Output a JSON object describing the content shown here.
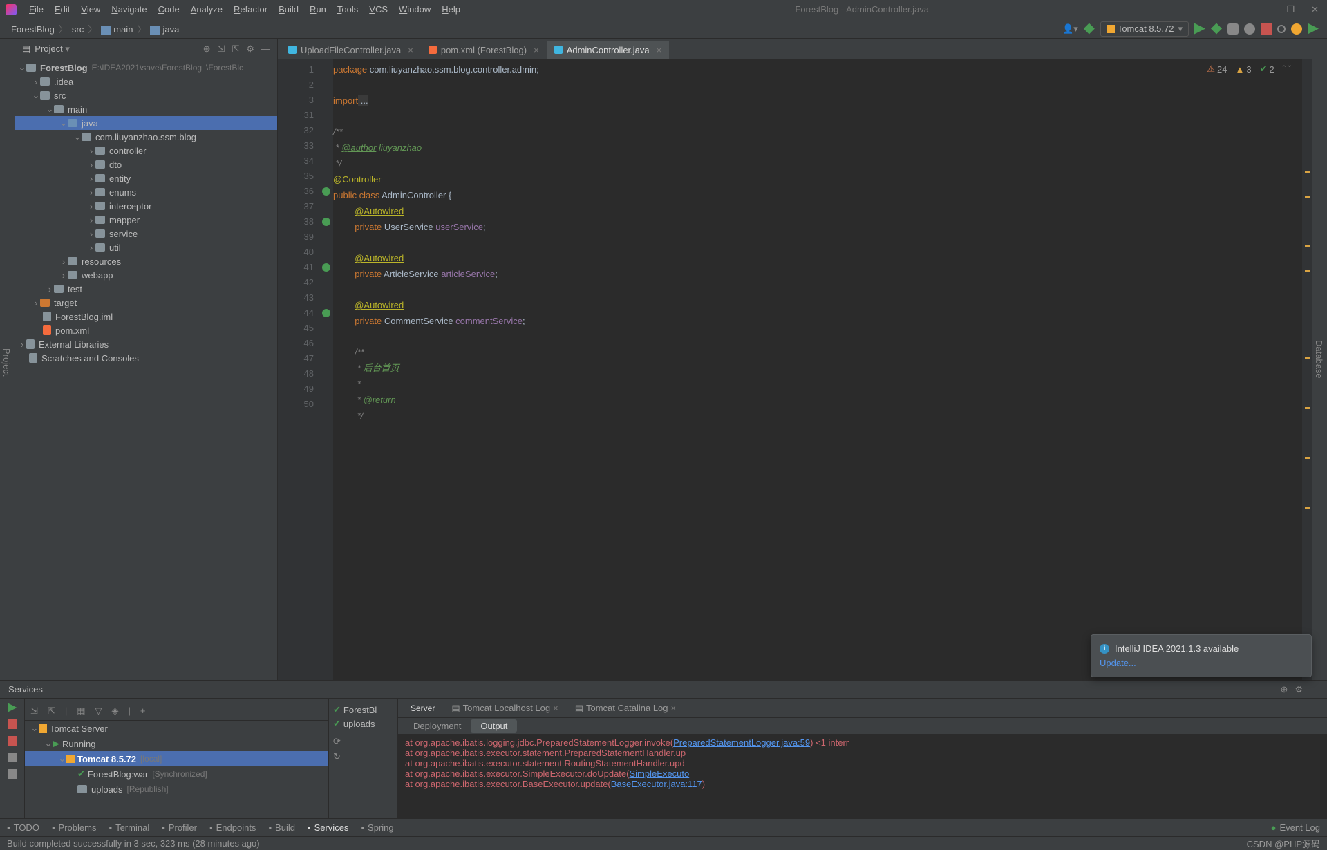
{
  "menu": [
    "File",
    "Edit",
    "View",
    "Navigate",
    "Code",
    "Analyze",
    "Refactor",
    "Build",
    "Run",
    "Tools",
    "VCS",
    "Window",
    "Help"
  ],
  "windowTitle": "ForestBlog - AdminController.java",
  "breadcrumb": [
    "ForestBlog",
    "src",
    "main",
    "java"
  ],
  "runConfig": "Tomcat 8.5.72",
  "projectPanel": {
    "title": "Project"
  },
  "tree": {
    "root": {
      "label": "ForestBlog",
      "path": "E:\\IDEA2021\\save\\ForestBlog",
      "suffix": "\\ForestBlc"
    },
    "idea": ".idea",
    "src": "src",
    "main": "main",
    "java": "java",
    "pkg": "com.liuyanzhao.ssm.blog",
    "folders": [
      "controller",
      "dto",
      "entity",
      "enums",
      "interceptor",
      "mapper",
      "service",
      "util"
    ],
    "resources": "resources",
    "webapp": "webapp",
    "test": "test",
    "target": "target",
    "iml": "ForestBlog.iml",
    "pom": "pom.xml",
    "extlib": "External Libraries",
    "scratches": "Scratches and Consoles"
  },
  "tabs": [
    {
      "label": "UploadFileController.java",
      "icon": "c"
    },
    {
      "label": "pom.xml (ForestBlog)",
      "icon": "m"
    },
    {
      "label": "AdminController.java",
      "icon": "c",
      "active": true
    }
  ],
  "annotations": {
    "warn1": "24",
    "warn2": "3",
    "ok": "2"
  },
  "gutterLines": [
    "1",
    "2",
    "3",
    "31",
    "32",
    "33",
    "34",
    "35",
    "36",
    "37",
    "38",
    "39",
    "40",
    "41",
    "42",
    "43",
    "44",
    "45",
    "46",
    "47",
    "48",
    "49",
    "50"
  ],
  "code": {
    "l1a": "package",
    "l1b": " com.liuyanzhao.ssm.blog.controller.admin;",
    "l3a": "import",
    "l3b": " ...",
    "l32": "/**",
    "l33a": " * ",
    "l33b": "@author",
    "l33c": " liuyanzhao",
    "l34": " */",
    "l35": "@Controller",
    "l36a": "public",
    "l36b": " class",
    "l36c": " AdminController",
    "l36d": " {",
    "l37": "@Autowired",
    "l38a": "private",
    "l38b": " UserService ",
    "l38c": "userService",
    "l38d": ";",
    "l40": "@Autowired",
    "l41a": "private",
    "l41b": " ArticleService ",
    "l41c": "articleService",
    "l41d": ";",
    "l43": "@Autowired",
    "l44a": "private",
    "l44b": " CommentService ",
    "l44c": "commentService",
    "l44d": ";",
    "l46": "/**",
    "l47a": " * ",
    "l47b": "后台首页",
    "l48": " *",
    "l49a": " * ",
    "l49b": "@return",
    "l50": " */"
  },
  "services": {
    "title": "Services",
    "tree": {
      "tomcatServer": "Tomcat Server",
      "running": "Running",
      "tomcat": "Tomcat 8.5.72",
      "tomcatSuffix": "[local]",
      "war": "ForestBlog:war",
      "warSuffix": "[Synchronized]",
      "uploads": "uploads",
      "uploadsSuffix": "[Republish]"
    },
    "midItems": [
      "ForestBl",
      "uploads"
    ],
    "tabs": [
      "Server",
      "Tomcat Localhost Log",
      "Tomcat Catalina Log"
    ],
    "subtabs": [
      "Deployment",
      "Output"
    ],
    "console": [
      {
        "pre": "    at org.apache.ibatis.logging.jdbc.PreparedStatementLogger.invoke(",
        "link": "PreparedStatementLogger.java:59",
        "post": ") <1 interr"
      },
      {
        "pre": "    at org.apache.ibatis.executor.statement.PreparedStatementHandler.up"
      },
      {
        "pre": "    at org.apache.ibatis.executor.statement.RoutingStatementHandler.upd"
      },
      {
        "pre": "    at org.apache.ibatis.executor.SimpleExecutor.doUpdate(",
        "link": "SimpleExecuto"
      },
      {
        "pre": "    at org.apache.ibatis.executor.BaseExecutor.update(",
        "link": "BaseExecutor.java:117",
        "post": ")"
      }
    ]
  },
  "bottomBar": [
    "TODO",
    "Problems",
    "Terminal",
    "Profiler",
    "Endpoints",
    "Build",
    "Services",
    "Spring"
  ],
  "bottomBarActive": "Services",
  "eventLog": "Event Log",
  "statusText": "Build completed successfully in 3 sec, 323 ms (28 minutes ago)",
  "watermark": "CSDN @PHP源码",
  "popup": {
    "title": "IntelliJ IDEA 2021.1.3 available",
    "link": "Update..."
  }
}
